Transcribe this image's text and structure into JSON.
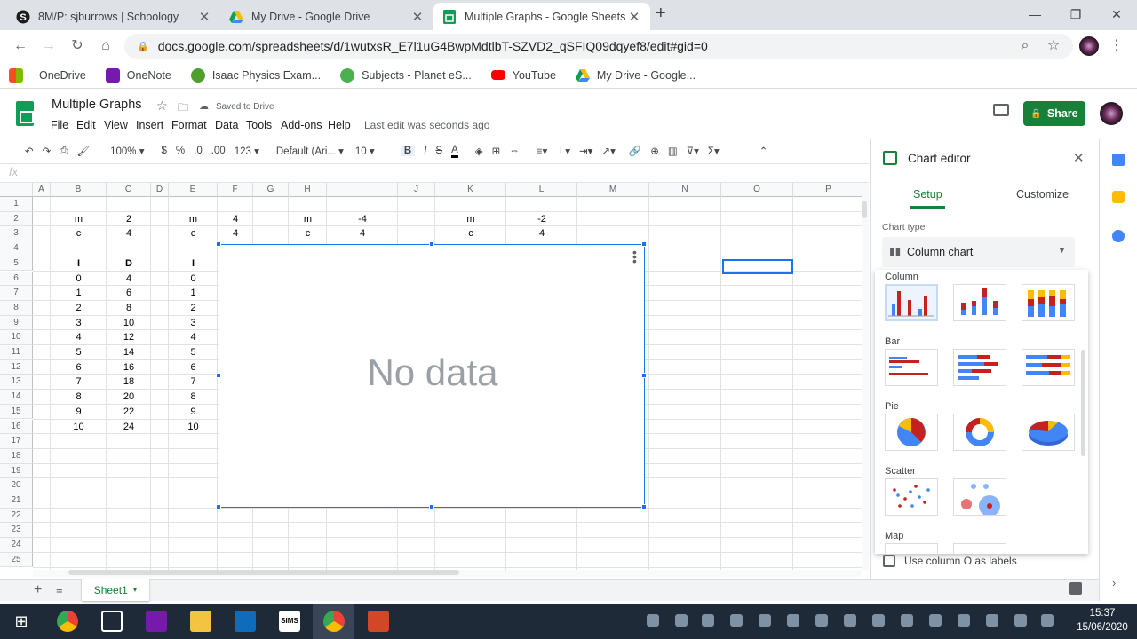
{
  "browser": {
    "tabs": [
      {
        "title": "8M/P: sjburrows | Schoology",
        "close": "✕"
      },
      {
        "title": "My Drive - Google Drive",
        "close": "✕"
      },
      {
        "title": "Multiple Graphs - Google Sheets",
        "close": "✕"
      }
    ],
    "new_tab": "+",
    "url": "docs.google.com/spreadsheets/d/1wutxsR_E7l1uG4BwpMdtlbT-SZVD2_qSFIQ09dqyef8/edit#gid=0",
    "bookmarks": [
      "OneDrive",
      "OneNote",
      "Isaac Physics Exam...",
      "Subjects - Planet eS...",
      "YouTube",
      "My Drive - Google..."
    ]
  },
  "sheets": {
    "doc_title": "Multiple Graphs",
    "saved_status": "Saved to Drive",
    "menu": [
      "File",
      "Edit",
      "View",
      "Insert",
      "Format",
      "Data",
      "Tools",
      "Add-ons",
      "Help"
    ],
    "last_edit": "Last edit was seconds ago",
    "share_label": "Share",
    "toolbar": {
      "zoom": "100%",
      "currency": "$",
      "percent": "%",
      "dec_less": ".0",
      "dec_more": ".00",
      "format": "123",
      "font": "Default (Ari...",
      "size": "10",
      "bold": "B",
      "italic": "I",
      "strike": "S",
      "textcolor": "A"
    },
    "fx": "fx",
    "columns": [
      "A",
      "B",
      "C",
      "D",
      "E",
      "F",
      "G",
      "H",
      "I",
      "J",
      "K",
      "L",
      "M",
      "N",
      "O",
      "P"
    ],
    "rows": [
      "1",
      "2",
      "3",
      "4",
      "5",
      "6",
      "7",
      "8",
      "9",
      "10",
      "11",
      "12",
      "13",
      "14",
      "15",
      "16",
      "17",
      "18",
      "19",
      "20",
      "21",
      "22",
      "23",
      "24",
      "25"
    ],
    "cells": [
      {
        "r": 2,
        "c": "B",
        "v": "m"
      },
      {
        "r": 2,
        "c": "C",
        "v": "2"
      },
      {
        "r": 2,
        "c": "E",
        "v": "m"
      },
      {
        "r": 2,
        "c": "F",
        "v": "4"
      },
      {
        "r": 2,
        "c": "H",
        "v": "m"
      },
      {
        "r": 2,
        "c": "I",
        "v": "-4"
      },
      {
        "r": 2,
        "c": "K",
        "v": "m"
      },
      {
        "r": 2,
        "c": "L",
        "v": "-2"
      },
      {
        "r": 3,
        "c": "B",
        "v": "c"
      },
      {
        "r": 3,
        "c": "C",
        "v": "4"
      },
      {
        "r": 3,
        "c": "E",
        "v": "c"
      },
      {
        "r": 3,
        "c": "F",
        "v": "4"
      },
      {
        "r": 3,
        "c": "H",
        "v": "c"
      },
      {
        "r": 3,
        "c": "I",
        "v": "4"
      },
      {
        "r": 3,
        "c": "K",
        "v": "c"
      },
      {
        "r": 3,
        "c": "L",
        "v": "4"
      },
      {
        "r": 5,
        "c": "B",
        "v": "I",
        "b": true
      },
      {
        "r": 5,
        "c": "C",
        "v": "D",
        "b": true
      },
      {
        "r": 5,
        "c": "E",
        "v": "I",
        "b": true
      },
      {
        "r": 6,
        "c": "B",
        "v": "0"
      },
      {
        "r": 6,
        "c": "C",
        "v": "4"
      },
      {
        "r": 6,
        "c": "E",
        "v": "0"
      },
      {
        "r": 7,
        "c": "B",
        "v": "1"
      },
      {
        "r": 7,
        "c": "C",
        "v": "6"
      },
      {
        "r": 7,
        "c": "E",
        "v": "1"
      },
      {
        "r": 8,
        "c": "B",
        "v": "2"
      },
      {
        "r": 8,
        "c": "C",
        "v": "8"
      },
      {
        "r": 8,
        "c": "E",
        "v": "2"
      },
      {
        "r": 9,
        "c": "B",
        "v": "3"
      },
      {
        "r": 9,
        "c": "C",
        "v": "10"
      },
      {
        "r": 9,
        "c": "E",
        "v": "3"
      },
      {
        "r": 10,
        "c": "B",
        "v": "4"
      },
      {
        "r": 10,
        "c": "C",
        "v": "12"
      },
      {
        "r": 10,
        "c": "E",
        "v": "4"
      },
      {
        "r": 11,
        "c": "B",
        "v": "5"
      },
      {
        "r": 11,
        "c": "C",
        "v": "14"
      },
      {
        "r": 11,
        "c": "E",
        "v": "5"
      },
      {
        "r": 12,
        "c": "B",
        "v": "6"
      },
      {
        "r": 12,
        "c": "C",
        "v": "16"
      },
      {
        "r": 12,
        "c": "E",
        "v": "6"
      },
      {
        "r": 13,
        "c": "B",
        "v": "7"
      },
      {
        "r": 13,
        "c": "C",
        "v": "18"
      },
      {
        "r": 13,
        "c": "E",
        "v": "7"
      },
      {
        "r": 14,
        "c": "B",
        "v": "8"
      },
      {
        "r": 14,
        "c": "C",
        "v": "20"
      },
      {
        "r": 14,
        "c": "E",
        "v": "8"
      },
      {
        "r": 15,
        "c": "B",
        "v": "9"
      },
      {
        "r": 15,
        "c": "C",
        "v": "22"
      },
      {
        "r": 15,
        "c": "E",
        "v": "9"
      },
      {
        "r": 16,
        "c": "B",
        "v": "10"
      },
      {
        "r": 16,
        "c": "C",
        "v": "24"
      },
      {
        "r": 16,
        "c": "E",
        "v": "10"
      }
    ],
    "chart_placeholder": "No data",
    "sheet_tab": "Sheet1",
    "add_sheet": "+"
  },
  "editor": {
    "title": "Chart editor",
    "tabs": [
      "Setup",
      "Customize"
    ],
    "chart_type_label": "Chart type",
    "chart_type_value": "Column chart",
    "gallery_sections": [
      "Column",
      "Bar",
      "Pie",
      "Scatter",
      "Map"
    ],
    "use_column_label": "Use column O as labels"
  },
  "taskbar": {
    "time": "15:37",
    "date": "15/06/2020",
    "sims": "SIMS"
  },
  "colors": {
    "accent": "#1a73e8",
    "green": "#188038",
    "red": "#c5221f",
    "blue": "#4285f4",
    "yellow": "#fbbc04"
  }
}
